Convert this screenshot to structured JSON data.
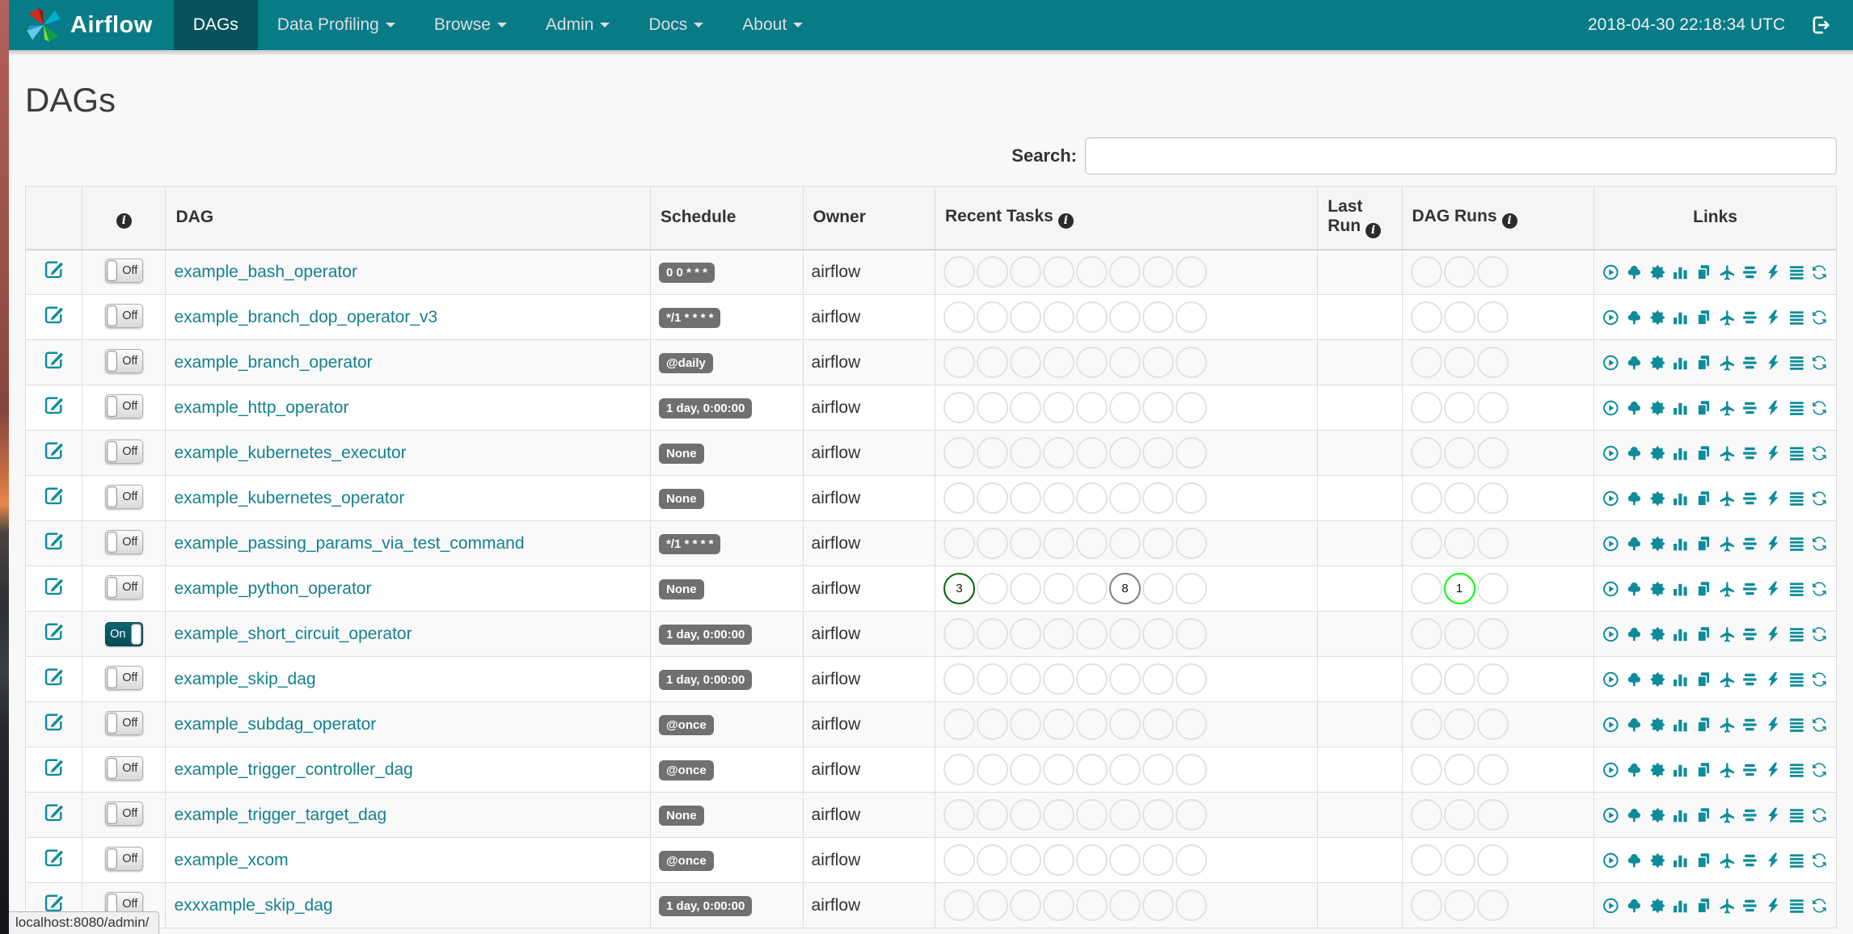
{
  "navbar": {
    "brand": "Airflow",
    "items": [
      {
        "label": "DAGs",
        "active": true,
        "dropdown": false
      },
      {
        "label": "Data Profiling",
        "active": false,
        "dropdown": true
      },
      {
        "label": "Browse",
        "active": false,
        "dropdown": true
      },
      {
        "label": "Admin",
        "active": false,
        "dropdown": true
      },
      {
        "label": "Docs",
        "active": false,
        "dropdown": true
      },
      {
        "label": "About",
        "active": false,
        "dropdown": true
      }
    ],
    "clock": "2018-04-30 22:18:34 UTC"
  },
  "page": {
    "title": "DAGs"
  },
  "search": {
    "label": "Search:",
    "value": ""
  },
  "table": {
    "headers": {
      "dag": "DAG",
      "schedule": "Schedule",
      "owner": "Owner",
      "recent_tasks": "Recent Tasks",
      "last_run": "Last Run",
      "dag_runs": "DAG Runs",
      "links": "Links"
    },
    "recent_task_slots": 8,
    "dag_run_slots": 3,
    "link_icons": [
      "trigger-dag",
      "tree-view",
      "graph-view",
      "task-duration",
      "task-tries",
      "landing-times",
      "gantt",
      "code-view",
      "logs",
      "refresh"
    ],
    "rows": [
      {
        "name": "example_bash_operator",
        "toggle": "Off",
        "schedule": "0 0 * * *",
        "owner": "airflow",
        "last_run": "",
        "recent_tasks": [],
        "dag_runs": []
      },
      {
        "name": "example_branch_dop_operator_v3",
        "toggle": "Off",
        "schedule": "*/1 * * * *",
        "owner": "airflow",
        "last_run": "",
        "recent_tasks": [],
        "dag_runs": []
      },
      {
        "name": "example_branch_operator",
        "toggle": "Off",
        "schedule": "@daily",
        "owner": "airflow",
        "last_run": "",
        "recent_tasks": [],
        "dag_runs": []
      },
      {
        "name": "example_http_operator",
        "toggle": "Off",
        "schedule": "1 day, 0:00:00",
        "owner": "airflow",
        "last_run": "",
        "recent_tasks": [],
        "dag_runs": []
      },
      {
        "name": "example_kubernetes_executor",
        "toggle": "Off",
        "schedule": "None",
        "owner": "airflow",
        "last_run": "",
        "recent_tasks": [],
        "dag_runs": []
      },
      {
        "name": "example_kubernetes_operator",
        "toggle": "Off",
        "schedule": "None",
        "owner": "airflow",
        "last_run": "",
        "recent_tasks": [],
        "dag_runs": []
      },
      {
        "name": "example_passing_params_via_test_command",
        "toggle": "Off",
        "schedule": "*/1 * * * *",
        "owner": "airflow",
        "last_run": "",
        "recent_tasks": [],
        "dag_runs": []
      },
      {
        "name": "example_python_operator",
        "toggle": "Off",
        "schedule": "None",
        "owner": "airflow",
        "last_run": "",
        "recent_tasks": [
          {
            "slot": 0,
            "count": 3,
            "state": "success"
          },
          {
            "slot": 5,
            "count": 8,
            "state": "queued"
          }
        ],
        "dag_runs": [
          {
            "slot": 1,
            "count": 1,
            "state": "running"
          }
        ]
      },
      {
        "name": "example_short_circuit_operator",
        "toggle": "On",
        "schedule": "1 day, 0:00:00",
        "owner": "airflow",
        "last_run": "",
        "recent_tasks": [],
        "dag_runs": []
      },
      {
        "name": "example_skip_dag",
        "toggle": "Off",
        "schedule": "1 day, 0:00:00",
        "owner": "airflow",
        "last_run": "",
        "recent_tasks": [],
        "dag_runs": []
      },
      {
        "name": "example_subdag_operator",
        "toggle": "Off",
        "schedule": "@once",
        "owner": "airflow",
        "last_run": "",
        "recent_tasks": [],
        "dag_runs": []
      },
      {
        "name": "example_trigger_controller_dag",
        "toggle": "Off",
        "schedule": "@once",
        "owner": "airflow",
        "last_run": "",
        "recent_tasks": [],
        "dag_runs": []
      },
      {
        "name": "example_trigger_target_dag",
        "toggle": "Off",
        "schedule": "None",
        "owner": "airflow",
        "last_run": "",
        "recent_tasks": [],
        "dag_runs": []
      },
      {
        "name": "example_xcom",
        "toggle": "Off",
        "schedule": "@once",
        "owner": "airflow",
        "last_run": "",
        "recent_tasks": [],
        "dag_runs": []
      },
      {
        "name": "exxxample_skip_dag",
        "toggle": "Off",
        "schedule": "1 day, 0:00:00",
        "owner": "airflow",
        "last_run": "",
        "recent_tasks": [],
        "dag_runs": []
      }
    ]
  },
  "status_bar": {
    "text": "localhost:8080/admin/"
  },
  "colors": {
    "navbar": "#077C87",
    "navbar_active": "#06525B",
    "accent_teal": "#0E8C9B",
    "link_teal": "#13818E",
    "badge_gray": "#707070",
    "empty_circle": "#e2e2e2",
    "toggle_on": "#075964",
    "state_colors": {
      "success": "#006400",
      "queued": "#808080",
      "running": "#00FF00"
    }
  }
}
